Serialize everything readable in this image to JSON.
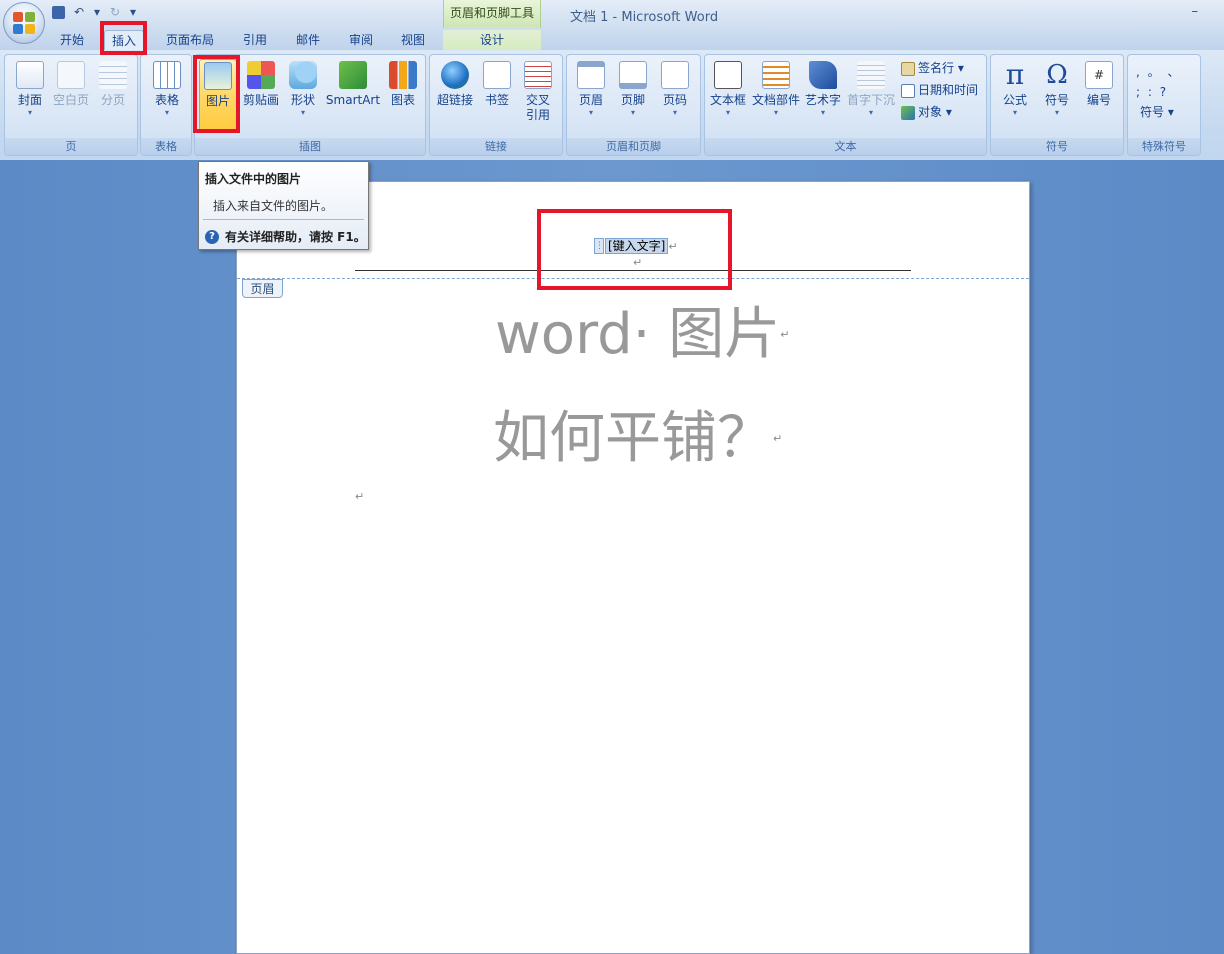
{
  "window": {
    "title": "文档 1 - Microsoft Word",
    "minimize": "–"
  },
  "qat": {
    "save_icon": "save-icon",
    "undo": "↶",
    "undo_drop": "▾",
    "redo": "↻",
    "customize": "▾"
  },
  "context_tool": {
    "label": "页眉和页脚工具",
    "tab": "设计"
  },
  "tabs": [
    {
      "label": "开始"
    },
    {
      "label": "插入"
    },
    {
      "label": "页面布局"
    },
    {
      "label": "引用"
    },
    {
      "label": "邮件"
    },
    {
      "label": "审阅"
    },
    {
      "label": "视图"
    }
  ],
  "ribbon": {
    "groups": {
      "page": "页",
      "table": "表格",
      "illustrations": "插图",
      "links": "链接",
      "header_footer": "页眉和页脚",
      "text": "文本",
      "symbols": "符号",
      "special": "特殊符号"
    },
    "page": {
      "cover": "封面",
      "blank": "空白页",
      "break": "分页"
    },
    "table": {
      "table": "表格"
    },
    "illustrations": {
      "picture": "图片",
      "clipart": "剪贴画",
      "shapes": "形状",
      "smartart": "SmartArt",
      "chart": "图表"
    },
    "links": {
      "hyperlink": "超链接",
      "bookmark": "书签",
      "cross1": "交叉",
      "cross2": "引用"
    },
    "header_footer": {
      "header": "页眉",
      "footer": "页脚",
      "pagenum": "页码"
    },
    "text": {
      "textbox": "文本框",
      "quickparts": "文档部件",
      "wordart": "艺术字",
      "dropcap": "首字下沉",
      "signature": "签名行 ▾",
      "datetime": "日期和时间",
      "object": "对象 ▾"
    },
    "symbols": {
      "equation": "公式",
      "symbol": "符号",
      "number": "编号"
    },
    "special": {
      "row1": ",  。 、",
      "row2": ";  :  ?",
      "symbol": "符号 ▾"
    }
  },
  "arrow": "▾",
  "tooltip": {
    "title": "插入文件中的图片",
    "desc": "插入来自文件的图片。",
    "help": "有关详细帮助，请按 F1。",
    "help_icon": "?"
  },
  "document": {
    "header_field": "[键入文字]",
    "header_tag": "页眉",
    "line1": "word· 图片",
    "line2": "如何平铺？",
    "para_mark": "↵"
  }
}
